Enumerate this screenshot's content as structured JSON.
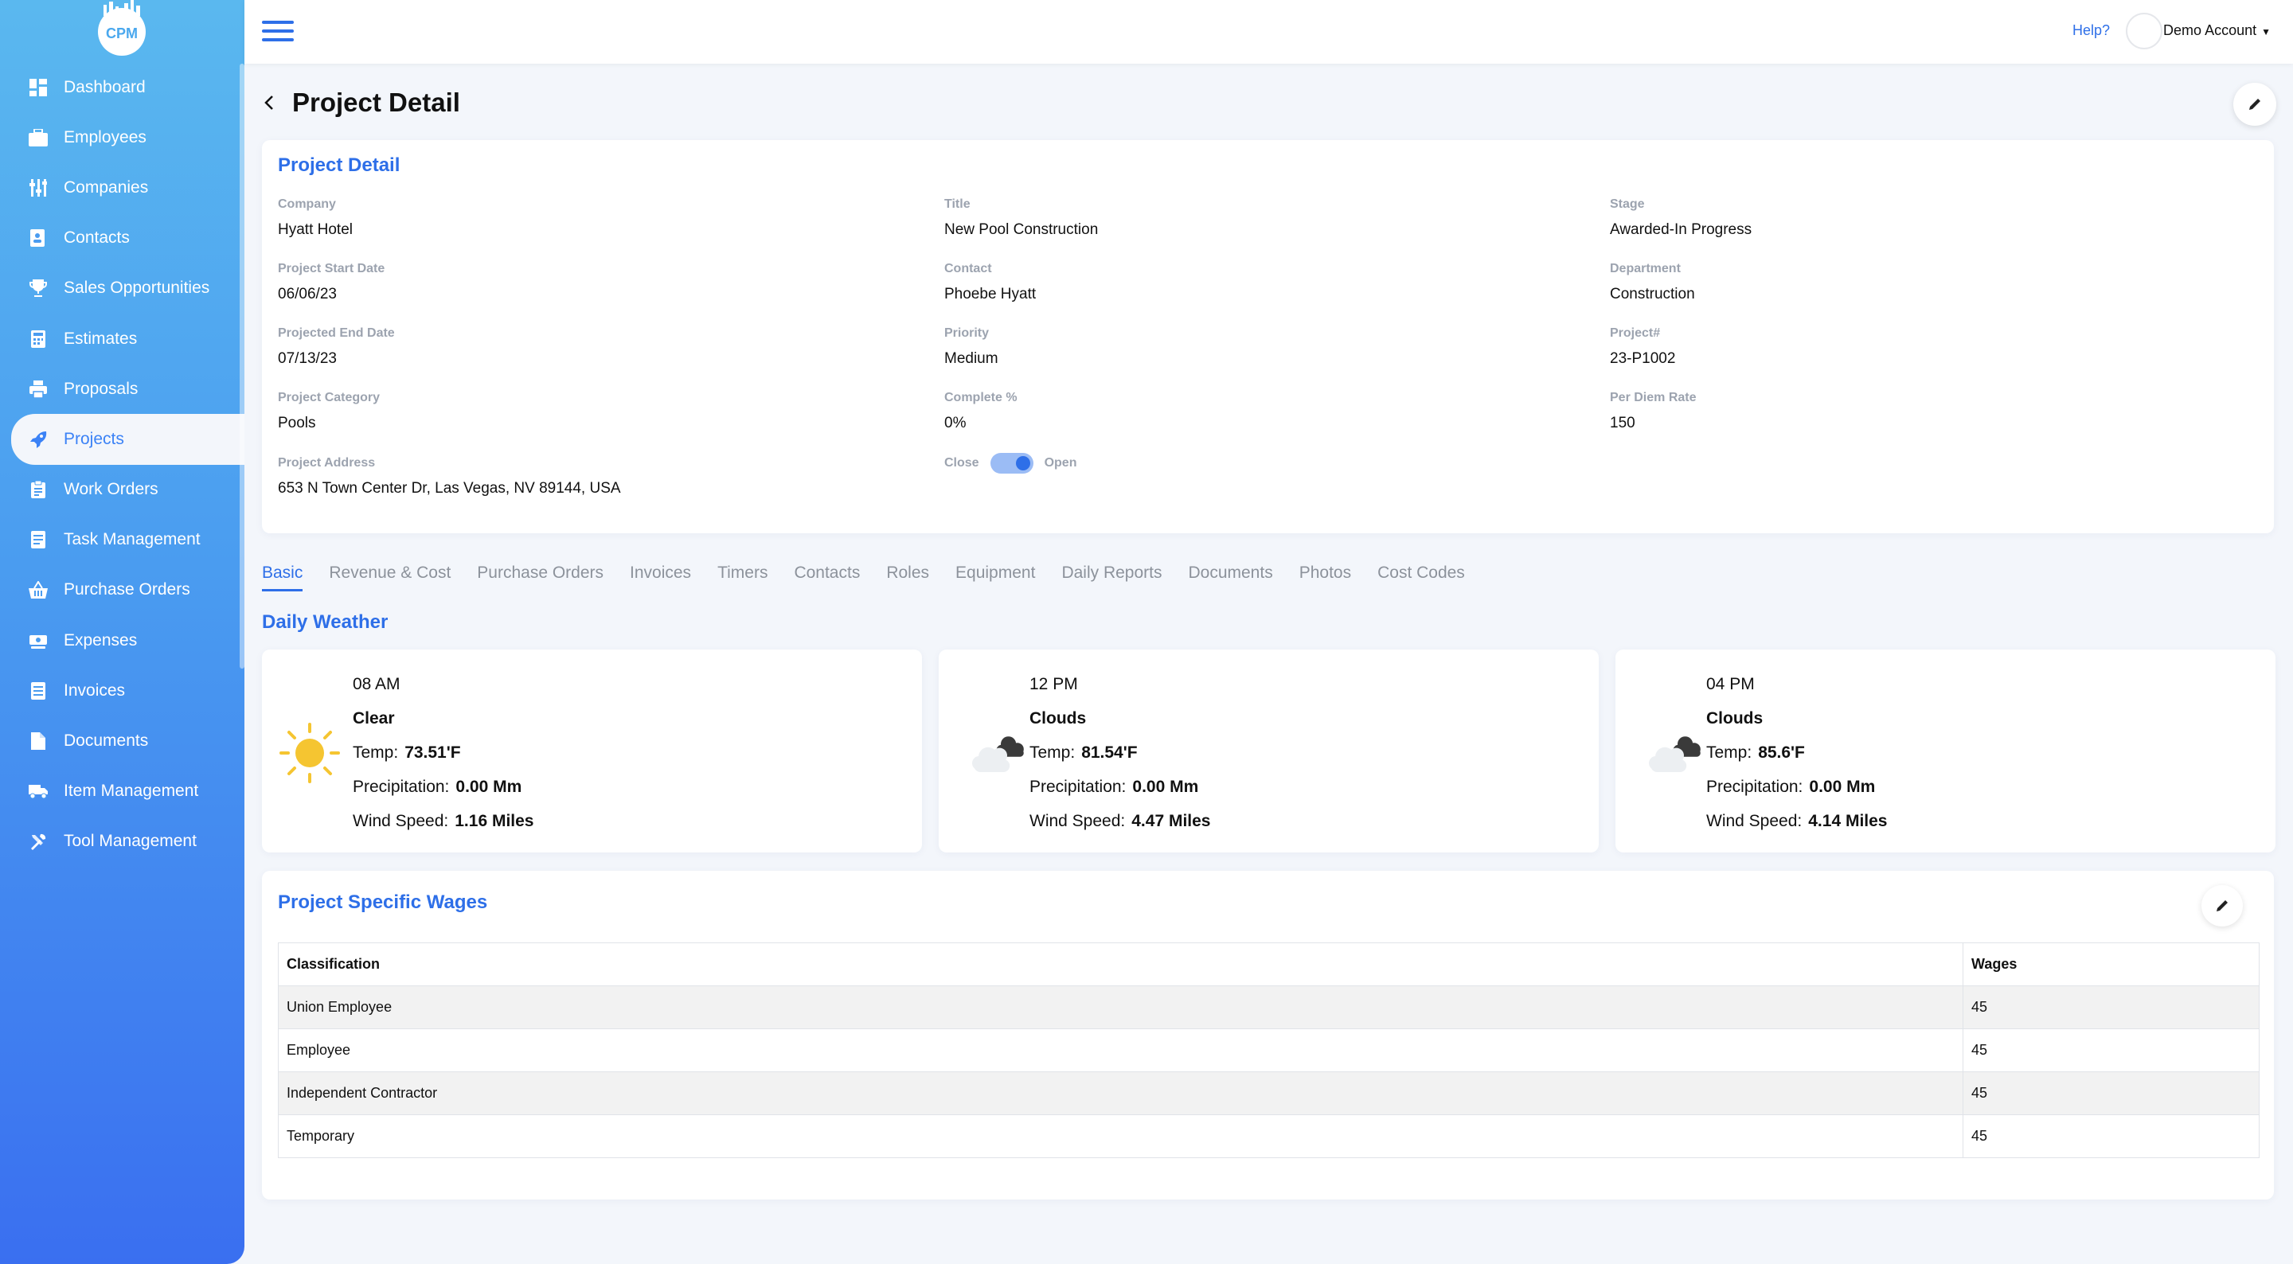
{
  "app": {
    "logo_text": "CPM"
  },
  "sidebar": {
    "items": [
      {
        "label": "Dashboard",
        "icon": "dashboard-icon",
        "active": false
      },
      {
        "label": "Employees",
        "icon": "briefcase-icon",
        "active": false
      },
      {
        "label": "Companies",
        "icon": "sliders-icon",
        "active": false
      },
      {
        "label": "Contacts",
        "icon": "address-book-icon",
        "active": false
      },
      {
        "label": "Sales Opportunities",
        "icon": "trophy-icon",
        "active": false
      },
      {
        "label": "Estimates",
        "icon": "calculator-icon",
        "active": false
      },
      {
        "label": "Proposals",
        "icon": "printer-icon",
        "active": false
      },
      {
        "label": "Projects",
        "icon": "rocket-icon",
        "active": true
      },
      {
        "label": "Work Orders",
        "icon": "clipboard-icon",
        "active": false
      },
      {
        "label": "Task Management",
        "icon": "task-list-icon",
        "active": false
      },
      {
        "label": "Purchase Orders",
        "icon": "basket-icon",
        "active": false
      },
      {
        "label": "Expenses",
        "icon": "money-icon",
        "active": false
      },
      {
        "label": "Invoices",
        "icon": "invoice-icon",
        "active": false
      },
      {
        "label": "Documents",
        "icon": "document-icon",
        "active": false
      },
      {
        "label": "Item Management",
        "icon": "truck-icon",
        "active": false
      },
      {
        "label": "Tool Management",
        "icon": "tools-icon",
        "active": false
      }
    ]
  },
  "topbar": {
    "help": "Help?",
    "account": "Demo Account"
  },
  "page": {
    "title": "Project Detail"
  },
  "detail": {
    "title": "Project Detail",
    "fields": [
      {
        "label": "Company",
        "value": "Hyatt Hotel"
      },
      {
        "label": "Title",
        "value": "New Pool Construction"
      },
      {
        "label": "Stage",
        "value": "Awarded-In Progress"
      },
      {
        "label": "Project Start Date",
        "value": "06/06/23"
      },
      {
        "label": "Contact",
        "value": "Phoebe Hyatt"
      },
      {
        "label": "Department",
        "value": "Construction"
      },
      {
        "label": "Projected End Date",
        "value": "07/13/23"
      },
      {
        "label": "Priority",
        "value": "Medium"
      },
      {
        "label": "Project#",
        "value": "23-P1002"
      },
      {
        "label": "Project Category",
        "value": "Pools"
      },
      {
        "label": "Complete %",
        "value": "0%"
      },
      {
        "label": "Per Diem Rate",
        "value": "150"
      },
      {
        "label": "Project Address",
        "value": "653 N Town Center Dr, Las Vegas, NV 89144, USA"
      }
    ],
    "toggle": {
      "left_label": "Close",
      "right_label": "Open",
      "state": "Open"
    }
  },
  "tabs": [
    "Basic",
    "Revenue & Cost",
    "Purchase Orders",
    "Invoices",
    "Timers",
    "Contacts",
    "Roles",
    "Equipment",
    "Daily Reports",
    "Documents",
    "Photos",
    "Cost Codes"
  ],
  "active_tab": "Basic",
  "weather": {
    "title": "Daily Weather",
    "temp_label": "Temp:",
    "precip_label": "Precipitation:",
    "wind_label": "Wind Speed:",
    "cards": [
      {
        "time": "08 AM",
        "condition": "Clear",
        "icon": "sun-icon",
        "temp": "73.51'F",
        "precip": "0.00 Mm",
        "wind": "1.16 Miles"
      },
      {
        "time": "12 PM",
        "condition": "Clouds",
        "icon": "clouds-icon",
        "temp": "81.54'F",
        "precip": "0.00 Mm",
        "wind": "4.47 Miles"
      },
      {
        "time": "04 PM",
        "condition": "Clouds",
        "icon": "clouds-icon",
        "temp": "85.6'F",
        "precip": "0.00 Mm",
        "wind": "4.14 Miles"
      }
    ]
  },
  "wages": {
    "title": "Project Specific Wages",
    "headers": [
      "Classification",
      "Wages"
    ],
    "rows": [
      [
        "Union Employee",
        "45"
      ],
      [
        "Employee",
        "45"
      ],
      [
        "Independent Contractor",
        "45"
      ],
      [
        "Temporary",
        "45"
      ]
    ]
  },
  "colors": {
    "accent": "#2e6fe8",
    "sidebar_top": "#5ab8ef",
    "sidebar_bottom": "#3a6ff0",
    "sun": "#f5c531"
  }
}
